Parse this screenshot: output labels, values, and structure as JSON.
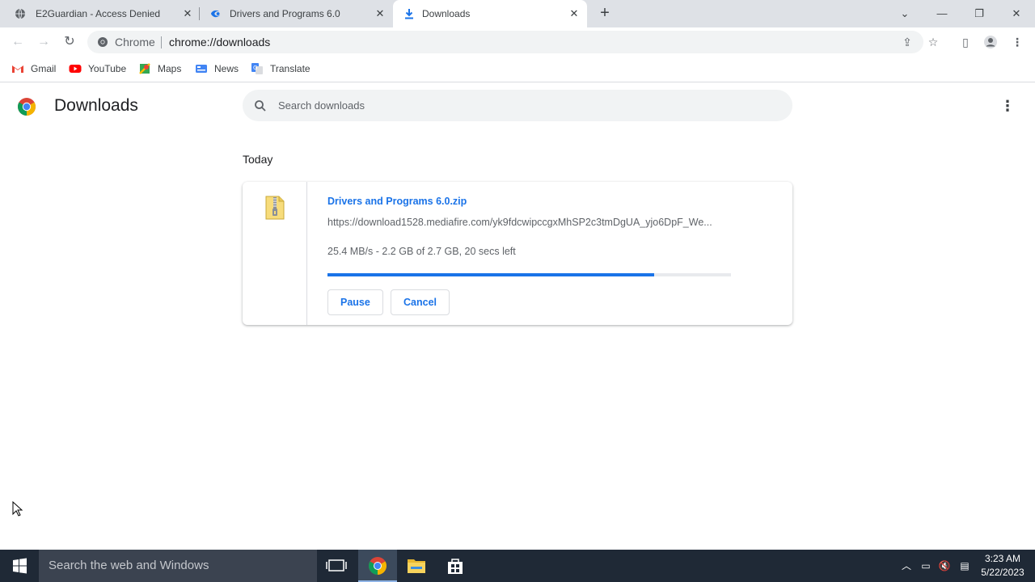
{
  "tabs": [
    {
      "title": "E2Guardian - Access Denied",
      "icon": "globe-icon",
      "active": false
    },
    {
      "title": "Drivers and Programs 6.0",
      "icon": "mediafire-icon",
      "active": false
    },
    {
      "title": "Downloads",
      "icon": "download-icon",
      "active": true
    }
  ],
  "omnibox": {
    "chip": "Chrome",
    "url": "chrome://downloads"
  },
  "bookmarks": [
    {
      "label": "Gmail",
      "icon": "gmail-icon"
    },
    {
      "label": "YouTube",
      "icon": "youtube-icon"
    },
    {
      "label": "Maps",
      "icon": "maps-icon"
    },
    {
      "label": "News",
      "icon": "news-icon"
    },
    {
      "label": "Translate",
      "icon": "translate-icon"
    }
  ],
  "page": {
    "title": "Downloads",
    "search_placeholder": "Search downloads",
    "section": "Today"
  },
  "download": {
    "filename": "Drivers and Programs 6.0.zip",
    "url": "https://download1528.mediafire.com/yk9fdcwipccgxMhSP2c3tmDgUA_yjo6DpF_We...",
    "status": "25.4 MB/s - 2.2 GB of 2.7 GB, 20 secs left",
    "progress_fraction": 0.81,
    "pause_label": "Pause",
    "cancel_label": "Cancel"
  },
  "taskbar": {
    "search_placeholder": "Search the web and Windows",
    "time": "3:23 AM",
    "date": "5/22/2023"
  },
  "colors": {
    "accent": "#1a73e8",
    "tabstrip": "#dee1e6",
    "taskbar": "#1f2936"
  }
}
